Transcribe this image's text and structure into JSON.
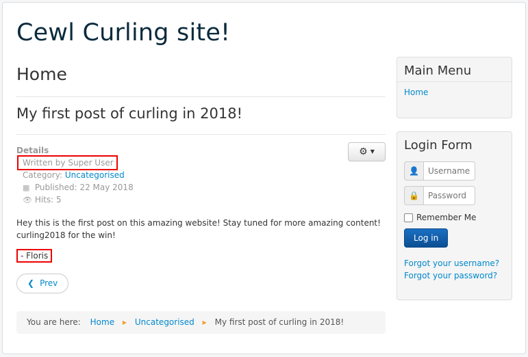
{
  "site": {
    "title": "Cewl Curling site!"
  },
  "main": {
    "page_heading": "Home",
    "article": {
      "title": "My first post of curling in 2018!",
      "details_label": "Details",
      "author": "Written by Super User",
      "category_label": "Category:",
      "category": "Uncategorised",
      "published": "Published: 22 May 2018",
      "hits": "Hits: 5",
      "body_line1": "Hey this is the first post on this amazing website! Stay tuned for more amazing content!",
      "body_line2": "curling2018 for the win!",
      "signature": "- Floris"
    },
    "prev_label": "Prev"
  },
  "breadcrumb": {
    "label": "You are here:",
    "items": [
      "Home",
      "Uncategorised",
      "My first post of curling in 2018!"
    ]
  },
  "sidebar": {
    "main_menu": {
      "title": "Main Menu",
      "items": [
        "Home"
      ]
    },
    "login_form": {
      "title": "Login Form",
      "username_placeholder": "Username",
      "password_placeholder": "Password",
      "remember_label": "Remember Me",
      "login_label": "Log in",
      "forgot_username": "Forgot your username?",
      "forgot_password": "Forgot your password?"
    }
  },
  "icons": [
    "gear-icon",
    "calendar-icon",
    "eye-icon",
    "chevron-left-icon",
    "user-icon",
    "lock-icon"
  ],
  "colors": {
    "link": "#0088cc",
    "login_button": "#0c4f93",
    "highlight_box": "#ee0000"
  }
}
